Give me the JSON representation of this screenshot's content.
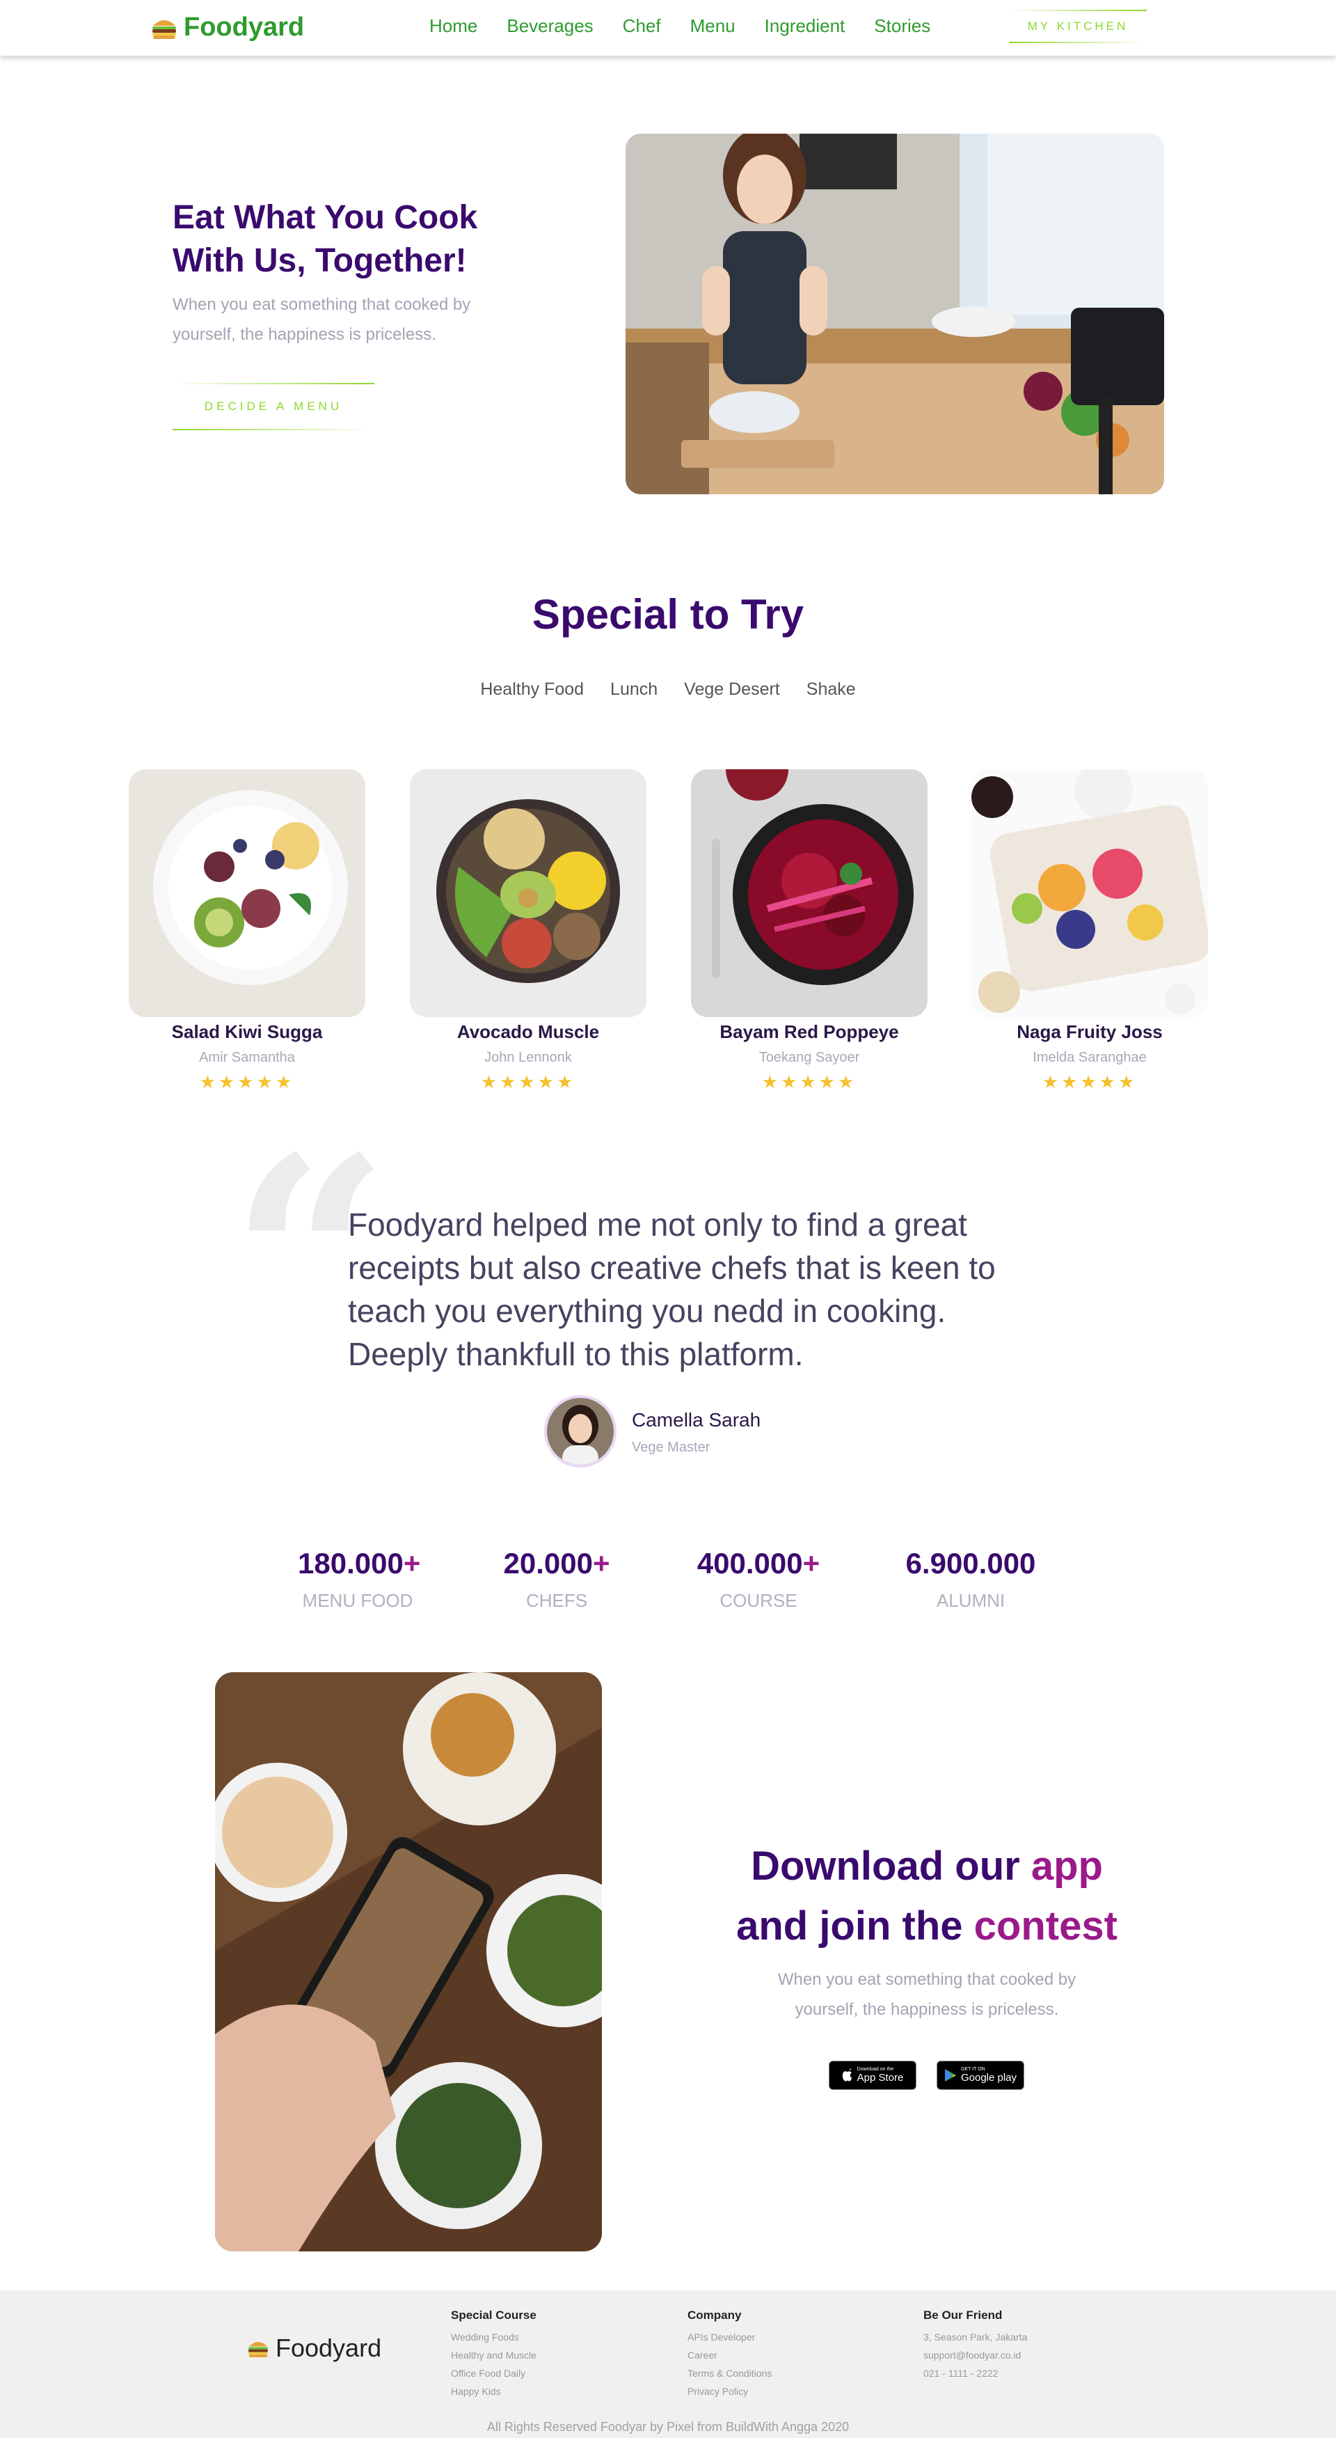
{
  "brand": {
    "name": "Foodyard"
  },
  "nav": {
    "links": [
      "Home",
      "Beverages",
      "Chef",
      "Menu",
      "Ingredient",
      "Stories"
    ],
    "cta": "MY KITCHEN"
  },
  "hero": {
    "title": "Eat What You Cook With Us, Together!",
    "subtitle": "When you eat something that cooked by yourself, the happiness is priceless.",
    "button": "DECIDE A MENU"
  },
  "special": {
    "title": "Special to Try",
    "tabs": [
      "Healthy Food",
      "Lunch",
      "Vege Desert",
      "Shake"
    ],
    "cards": [
      {
        "name": "Salad Kiwi Sugga",
        "author": "Amir Samantha",
        "rating": 5
      },
      {
        "name": "Avocado Muscle",
        "author": "John Lennonk",
        "rating": 5
      },
      {
        "name": "Bayam Red Poppeye",
        "author": "Toekang Sayoer",
        "rating": 5
      },
      {
        "name": "Naga Fruity Joss",
        "author": "Imelda Saranghae",
        "rating": 5
      }
    ]
  },
  "testimonial": {
    "quote": "Foodyard helped me not only to find a great receipts but also creative chefs that is keen to teach you everything you nedd in cooking. Deeply thankfull to this platform.",
    "author": "Camella Sarah",
    "role": "Vege Master"
  },
  "stats": [
    {
      "value": "180.000",
      "suffix": "+",
      "label": "MENU FOOD"
    },
    {
      "value": "20.000",
      "suffix": "+",
      "label": "CHEFS"
    },
    {
      "value": "400.000",
      "suffix": "+",
      "label": "COURSE"
    },
    {
      "value": "6.900.000",
      "suffix": "",
      "label": "ALUMNI"
    }
  ],
  "download": {
    "title_part1": "Download our ",
    "title_accent1": "app",
    "title_part2": "and join the ",
    "title_accent2": "contest",
    "subtitle": "When you eat something that cooked by yourself, the happiness is priceless.",
    "appstore_small": "Download on the",
    "appstore_big": "App Store",
    "googleplay_small": "GET IT ON",
    "googleplay_big": "Google play"
  },
  "footer": {
    "columns": [
      {
        "title": "Special Course",
        "links": [
          "Wedding Foods",
          "Healthy and Muscle",
          "Office Food Daily",
          "Happy Kids"
        ]
      },
      {
        "title": "Company",
        "links": [
          "APIs Developer",
          "Career",
          "Terms & Conditions",
          "Privacy Policy"
        ]
      },
      {
        "title": "Be Our Friend",
        "links": [
          "3, Season Park, Jakarta",
          "support@foodyar.co.id",
          "021 - 1111 - 2222"
        ]
      }
    ],
    "copyright": "All Rights Reserved Foodyar by Pixel from BuildWith Angga 2020"
  },
  "colors": {
    "brand_green": "#2e9b2e",
    "accent_lime": "#8dd62a",
    "purple": "#3a0a6e",
    "magenta": "#9a1a8a",
    "star": "#f5c130"
  }
}
